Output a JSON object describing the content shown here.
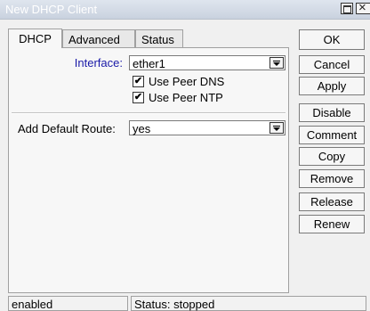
{
  "window": {
    "title": "New DHCP Client"
  },
  "tabs": [
    {
      "label": "DHCP",
      "active": true
    },
    {
      "label": "Advanced",
      "active": false
    },
    {
      "label": "Status",
      "active": false
    }
  ],
  "form": {
    "interface_label": "Interface:",
    "interface_value": "ether1",
    "use_peer_dns_label": "Use Peer DNS",
    "use_peer_dns_checked": true,
    "use_peer_ntp_label": "Use Peer NTP",
    "use_peer_ntp_checked": true,
    "add_default_route_label": "Add Default Route:",
    "add_default_route_value": "yes"
  },
  "buttons": {
    "ok": "OK",
    "cancel": "Cancel",
    "apply": "Apply",
    "disable": "Disable",
    "comment": "Comment",
    "copy": "Copy",
    "remove": "Remove",
    "release": "Release",
    "renew": "Renew"
  },
  "status_bar": {
    "state": "enabled",
    "status": "Status: stopped"
  },
  "check_mark": "✔",
  "colors": {
    "interface_label": "#1a1aa8",
    "titlebar": "#c9d2df"
  }
}
